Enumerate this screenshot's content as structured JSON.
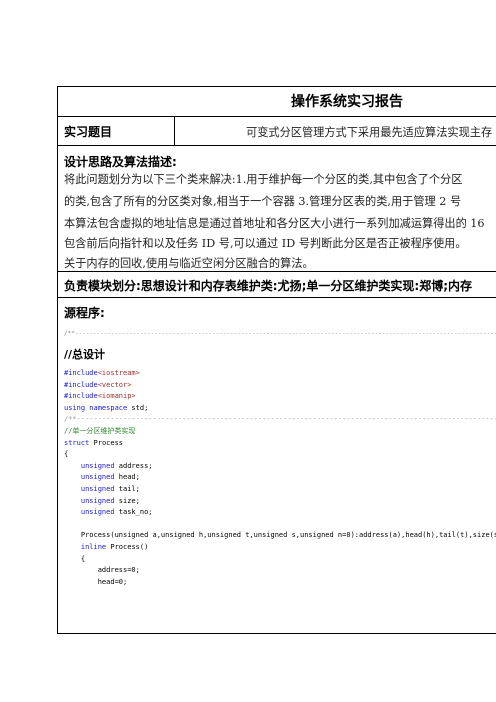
{
  "report": {
    "title": "操作系统实习报告",
    "topic_label": "实习题目",
    "topic_value": "可变式分区管理方式下采用最先适应算法实现主存",
    "design_label": "设计思路及算法描述:",
    "design_lines": [
      "将此问题划分为以下三个类来解决:1.用于维护每一个分区的类,其中包含了个分区",
      "的类,包含了所有的分区类对象,相当于一个容器 3.管理分区表的类,用于管理 2 号",
      "本算法包含虚拟的地址信息是通过首地址和各分区大小进行一系列加减运算得出的 16",
      "包含前后向指针和以及任务 ID 号,可以通过 ID 号判断此分区是否正被程序使用。",
      "关于内存的回收,使用与临近空闲分区融合的算法。"
    ],
    "division": "负责模块划分:思想设计和内存表维护类:尤扬;单一分区维护类实现:郑博;内存",
    "source_label": "源程序:",
    "dash_line": "/**----------------------------------------------------------------------------------------------------------------------------",
    "overall_comment": "//总设计",
    "code": {
      "inc1_kw": "#include",
      "inc1_str": "<iostream>",
      "inc2_kw": "#include",
      "inc2_str": "<vector>",
      "inc3_kw": "#include",
      "inc3_str": "<iomanip>",
      "using_kw": "using namespace",
      "using_rest": " std;",
      "dash2": "/**----------------------------------------------------------------------------------------------------------------------------",
      "comment_single": "//单一分区维护类实现",
      "struct_kw": "struct",
      "struct_name": " Process",
      "brace_open": "{",
      "f1_kw": "unsigned",
      "f1_rest": " address;",
      "f2_kw": "unsigned",
      "f2_rest": " head;",
      "f3_kw": "unsigned",
      "f3_rest": " tail;",
      "f4_kw": "unsigned",
      "f4_rest": " size;",
      "f5_kw": "unsigned",
      "f5_rest": " task_no;",
      "ctor": "Process(unsigned a,unsigned h,unsigned t,unsigned s,unsigned n=0):address(a),head(h),tail(t),size(s),task_",
      "inline_kw": "inline",
      "inline_rest": " Process()",
      "brace2": "{",
      "assign1": "address=0;",
      "assign2": "head=0;"
    }
  }
}
